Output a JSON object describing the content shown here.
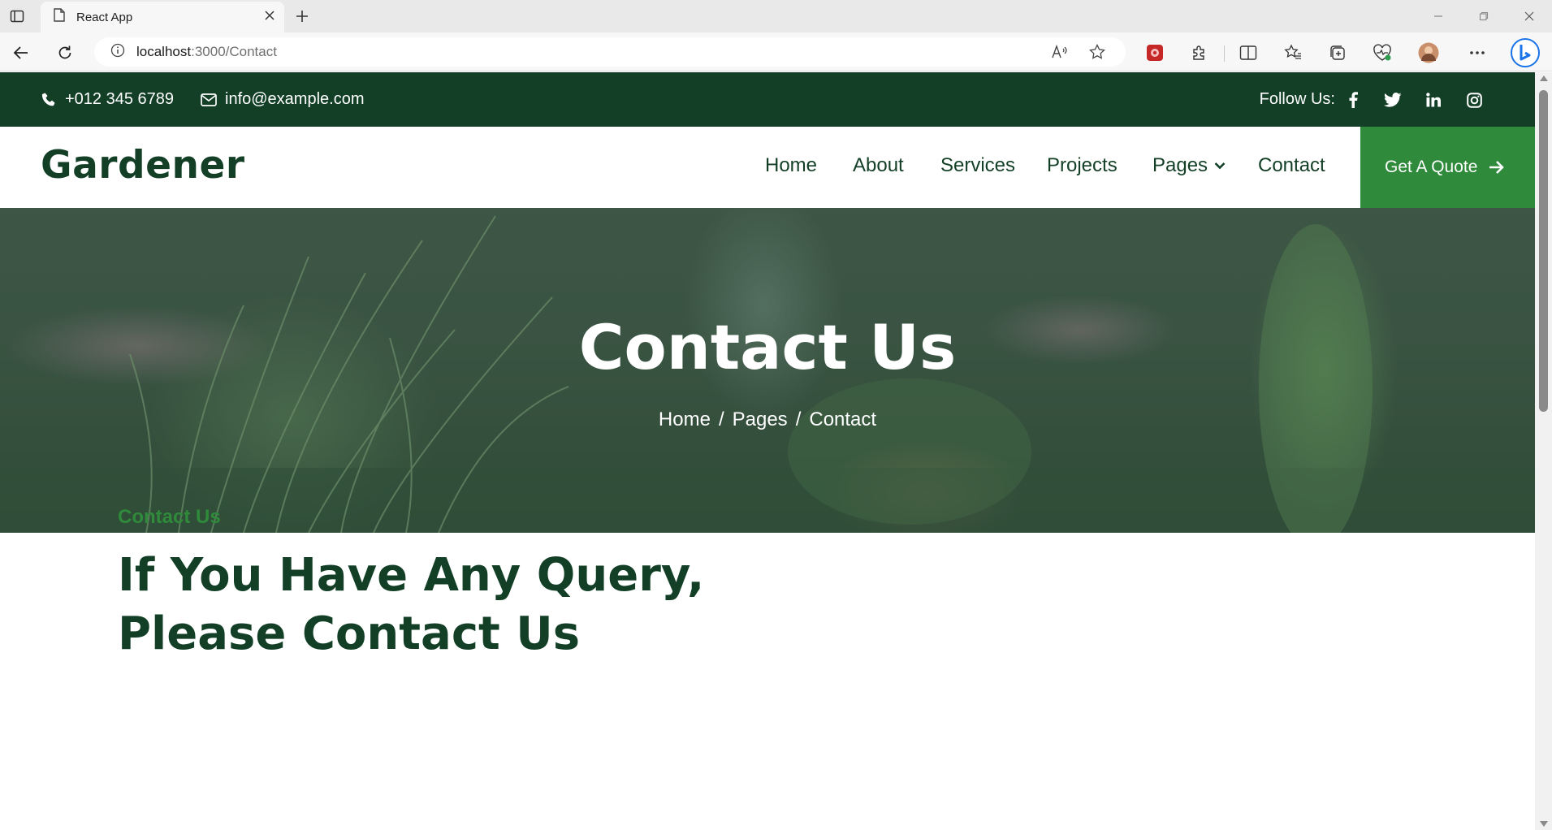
{
  "browser": {
    "tab_title": "React App",
    "url_host": "localhost",
    "url_path": ":3000/Contact"
  },
  "topbar": {
    "phone": "+012 345 6789",
    "email": "info@example.com",
    "follow_label": "Follow Us:",
    "social_icons": [
      "facebook-icon",
      "twitter-icon",
      "linkedin-icon",
      "instagram-icon"
    ]
  },
  "navbar": {
    "logo": "Gardener",
    "links": [
      "Home",
      "About",
      "Services",
      "Projects",
      "Pages",
      "Contact"
    ],
    "cta": "Get A Quote"
  },
  "hero": {
    "title": "Contact Us",
    "breadcrumb": [
      "Home",
      "Pages",
      "Contact"
    ]
  },
  "section": {
    "eyebrow": "Contact Us",
    "title_line1": "If You Have Any Query,",
    "title_line2": "Please Contact Us"
  },
  "colors": {
    "brand_dark": "#123f26",
    "brand_green": "#2f8a3b"
  }
}
